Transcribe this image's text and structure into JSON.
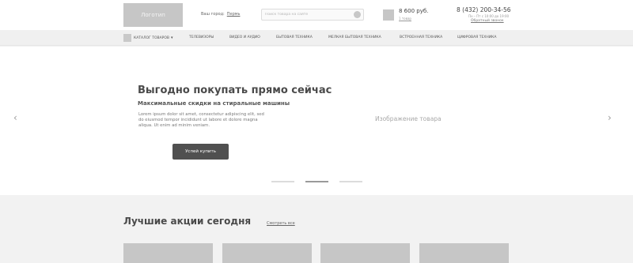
{
  "header": {
    "logo_text": "Логотип",
    "city_label": "Ваш город:",
    "city_value": "Пермь",
    "search_placeholder": "Поиск товара на сайте",
    "cart_price": "8 600 руб.",
    "cart_count": "1 товар",
    "phone": "8 (432) 200-34-56",
    "hours": "Пн – Пт с 10:00 до 19:00",
    "callback": "Обратный звонок"
  },
  "nav": {
    "catalog": "КАТАЛОГ ТОВАРОВ",
    "items": [
      "ТЕЛЕВИЗОРЫ",
      "ВИДЕО И АУДИО",
      "БЫТОВАЯ ТЕХНИКА",
      "МЕЛКАЯ БЫТОВАЯ ТЕХНИКА",
      "ВСТРОЕННАЯ ТЕХНИКА",
      "ЦИФРОВАЯ ТЕХНИКА"
    ]
  },
  "hero": {
    "title": "Выгодно покупать прямо сейчас",
    "subtitle": "Максимальные скидки на стиральные машины",
    "text": "Lorem ipsum dolor sit amet, consectetur adipiscing elit, sed do eiusmod tempor incididunt ut labore et dolore magna aliqua. Ut enim ad minim veniam.",
    "button": "Успей купить",
    "image_label": "Изображение товара",
    "prev_arrow": "‹",
    "next_arrow": "›",
    "active_slide": 2,
    "slide_count": 3
  },
  "promo": {
    "title": "Лучшие акции сегодня",
    "see_all": "Смотреть все"
  },
  "colors": {
    "placeholder_gray": "#c6c6c6",
    "button_dark": "#505050",
    "page_bg": "#f2f2f2",
    "header_bg": "#ffffff"
  }
}
